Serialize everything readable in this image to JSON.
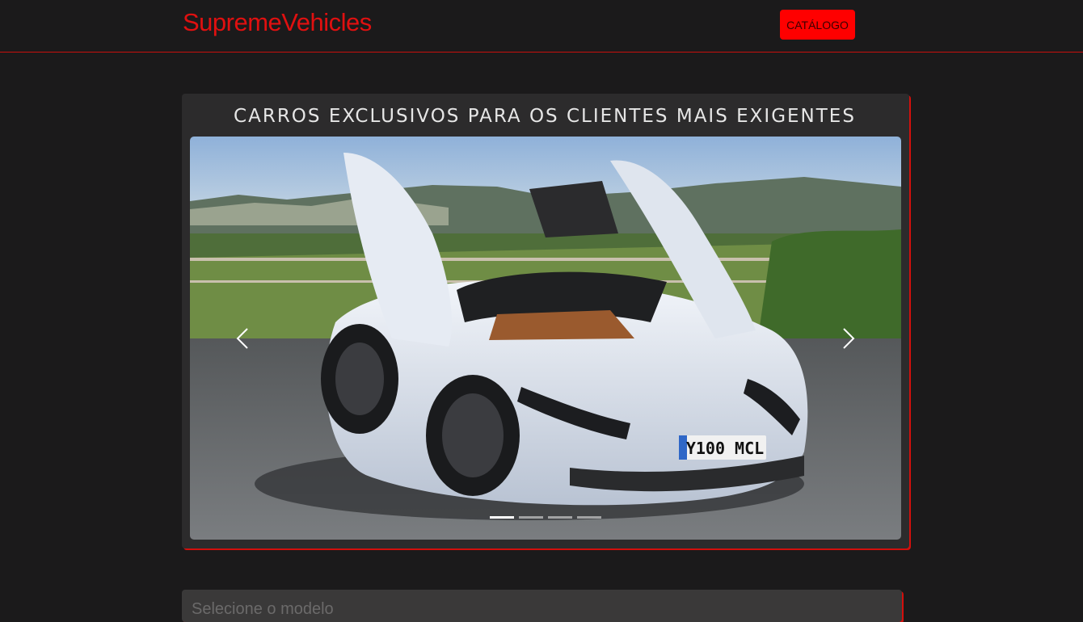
{
  "navbar": {
    "brand": "SupremeVehicles",
    "catalog_button": "CATÁLOGO"
  },
  "hero": {
    "title": "CARROS EXCLUSIVOS PARA OS CLIENTES MAIS EXIGENTES",
    "carousel": {
      "slide_image": "white-supercar-doors-open",
      "license_plate": "Y100 MCL",
      "indicators": [
        {
          "active": true
        },
        {
          "active": false
        },
        {
          "active": false
        },
        {
          "active": false
        }
      ]
    }
  },
  "model_select": {
    "placeholder": "Selecione o modelo"
  },
  "colors": {
    "accent": "#e01010",
    "button": "#ff0000",
    "background": "#1b1a1b",
    "card": "#2c2b2c"
  }
}
